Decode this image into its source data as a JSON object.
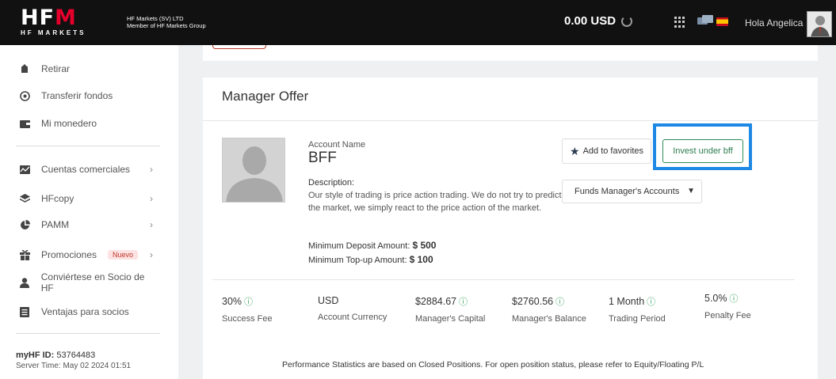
{
  "header": {
    "logo_main": "HFM",
    "logo_sub": "HF MARKETS",
    "company_line1": "HF Markets (SV) LTD",
    "company_line2": "Member of HF Markets Group",
    "balance": "0.00 USD",
    "greeting": "Hola Angelica"
  },
  "sidebar": {
    "items": [
      {
        "label": "Retirar",
        "icon": "withdraw-icon"
      },
      {
        "label": "Transferir fondos",
        "icon": "transfer-icon"
      },
      {
        "label": "Mi monedero",
        "icon": "wallet-icon"
      },
      {
        "label": "Cuentas comerciales",
        "icon": "chart-icon"
      },
      {
        "label": "HFcopy",
        "icon": "layers-icon"
      },
      {
        "label": "PAMM",
        "icon": "pie-icon"
      },
      {
        "label": "Promociones",
        "icon": "gift-icon",
        "badge": "Nuevo"
      },
      {
        "label": "Conviértese en Socio de HF",
        "icon": "user-icon"
      },
      {
        "label": "Ventajas para socios",
        "icon": "list-icon"
      }
    ],
    "footer_id_label": "myHF ID:",
    "footer_id_value": "53764483",
    "server_time": "Server Time: May 02 2024 01:51"
  },
  "offer": {
    "title": "Manager Offer",
    "account_name_label": "Account Name",
    "account_name": "BFF",
    "description_label": "Description:",
    "description": "Our style of trading is price action trading. We do not try to predict the market, we simply react to the price action of the market.",
    "min_deposit_label": "Minimum Deposit Amount:",
    "min_deposit_value": "$ 500",
    "min_topup_label": "Minimum Top-up Amount:",
    "min_topup_value": "$ 100",
    "add_favorites": "Add to favorites",
    "invest_button": "Invest under bff",
    "select_value": "Funds Manager's Accounts"
  },
  "stats": [
    {
      "value": "30%",
      "label": "Success Fee"
    },
    {
      "value": "USD",
      "label": "Account Currency"
    },
    {
      "value": "$2884.67",
      "label": "Manager's Capital"
    },
    {
      "value": "$2760.56",
      "label": "Manager's Balance"
    },
    {
      "value": "1 Month",
      "label": "Trading Period"
    },
    {
      "value": "5.0%",
      "label": "Penalty Fee"
    }
  ],
  "performance_note": "Performance Statistics are based on Closed Positions. For open position status, please refer to Equity/Floating P/L",
  "colors": {
    "topbar": "#111111",
    "brand_red": "#e4002b",
    "highlight_blue": "#1e88e5",
    "invest_green": "#2e8b57"
  }
}
